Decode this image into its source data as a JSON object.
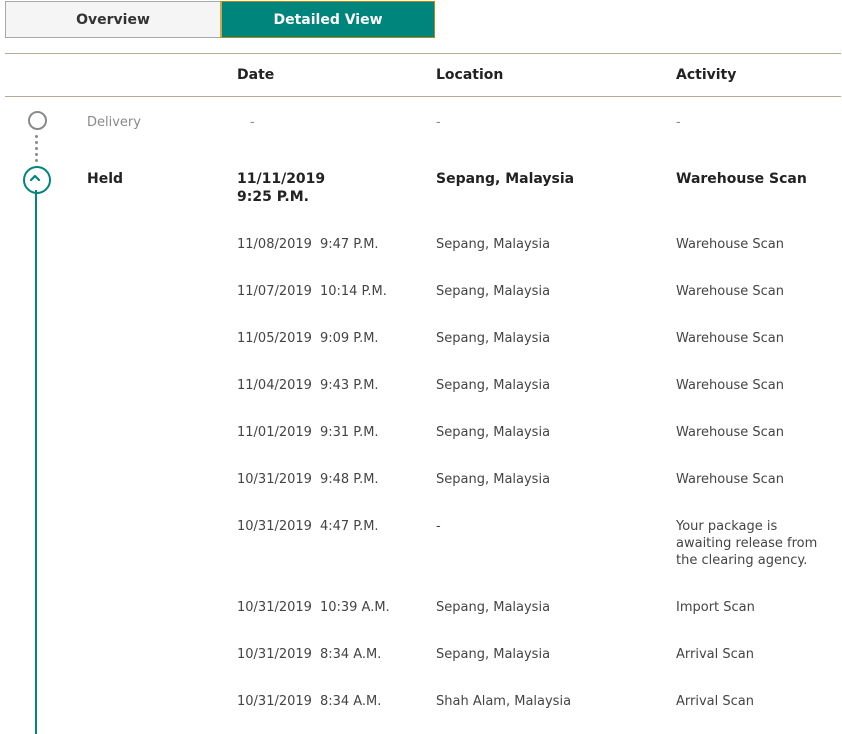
{
  "tabs": {
    "overview": "Overview",
    "detailed": "Detailed View"
  },
  "columns": {
    "date": "Date",
    "location": "Location",
    "activity": "Activity"
  },
  "delivery": {
    "label": "Delivery",
    "date": "-",
    "location": "-",
    "activity": "-"
  },
  "held": {
    "label": "Held",
    "date": "11/11/2019",
    "time": "9:25 P.M.",
    "location": "Sepang, Malaysia",
    "activity": "Warehouse Scan"
  },
  "events": [
    {
      "date": "11/08/2019",
      "time": "9:47 P.M.",
      "location": "Sepang, Malaysia",
      "activity": "Warehouse Scan"
    },
    {
      "date": "11/07/2019",
      "time": "10:14 P.M.",
      "location": "Sepang, Malaysia",
      "activity": "Warehouse Scan"
    },
    {
      "date": "11/05/2019",
      "time": "9:09 P.M.",
      "location": "Sepang, Malaysia",
      "activity": "Warehouse Scan"
    },
    {
      "date": "11/04/2019",
      "time": "9:43 P.M.",
      "location": "Sepang, Malaysia",
      "activity": "Warehouse Scan"
    },
    {
      "date": "11/01/2019",
      "time": "9:31 P.M.",
      "location": "Sepang, Malaysia",
      "activity": "Warehouse Scan"
    },
    {
      "date": "10/31/2019",
      "time": "9:48 P.M.",
      "location": "Sepang, Malaysia",
      "activity": "Warehouse Scan"
    },
    {
      "date": "10/31/2019",
      "time": "4:47 P.M.",
      "location": "-",
      "activity": "Your package is awaiting release from the clearing agency."
    },
    {
      "date": "10/31/2019",
      "time": "10:39 A.M.",
      "location": "Sepang, Malaysia",
      "activity": "Import Scan"
    },
    {
      "date": "10/31/2019",
      "time": "8:34 A.M.",
      "location": "Sepang, Malaysia",
      "activity": "Arrival Scan"
    },
    {
      "date": "10/31/2019",
      "time": "8:34 A.M.",
      "location": "Shah Alam, Malaysia",
      "activity": "Arrival Scan"
    }
  ],
  "icons": {
    "delivery_marker": "circle-icon",
    "held_marker": "chevron-up-icon"
  },
  "colors": {
    "accent": "#00857d",
    "tab_border": "#c7a94e",
    "rule": "#b5aa98",
    "muted": "#8a8a8a"
  }
}
